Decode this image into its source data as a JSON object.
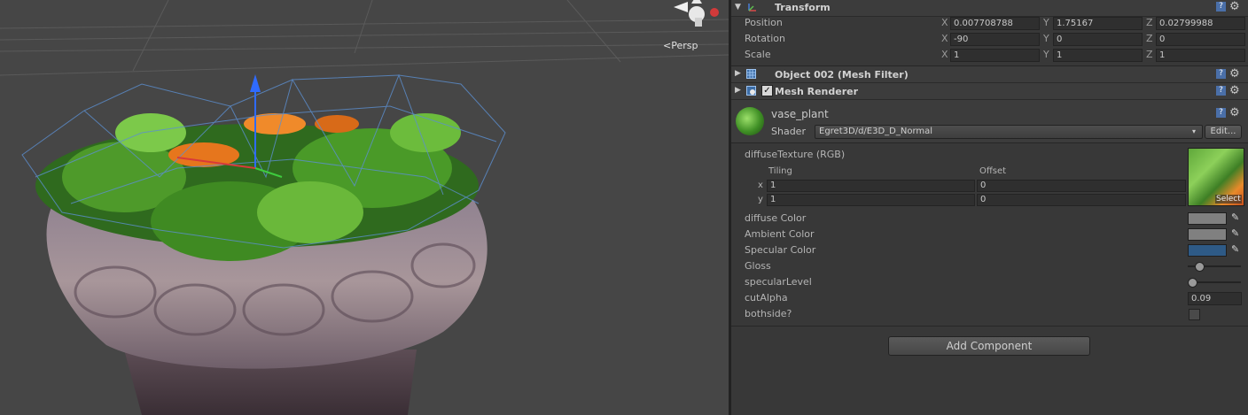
{
  "scene": {
    "view_label": "<Persp"
  },
  "transform": {
    "title": "Transform",
    "position": {
      "label": "Position",
      "x": "0.007708788",
      "y": "1.75167",
      "z": "0.02799988"
    },
    "rotation": {
      "label": "Rotation",
      "x": "-90",
      "y": "0",
      "z": "0"
    },
    "scale": {
      "label": "Scale",
      "x": "1",
      "y": "1",
      "z": "1"
    }
  },
  "axes": {
    "x": "X",
    "y": "Y",
    "z": "Z"
  },
  "mesh_filter": {
    "title": "Object 002 (Mesh Filter)"
  },
  "mesh_renderer": {
    "title": "Mesh Renderer",
    "enabled": true
  },
  "material": {
    "name": "vase_plant",
    "shader_label": "Shader",
    "shader_value": "Egret3D/d/E3D_D_Normal",
    "edit_label": "Edit...",
    "diffuse_texture_label": "diffuseTexture (RGB)",
    "tiling_label": "Tiling",
    "offset_label": "Offset",
    "row_x": "x",
    "row_y": "y",
    "tiling_x": "1",
    "tiling_y": "1",
    "offset_x": "0",
    "offset_y": "0",
    "select_label": "Select",
    "diffuse_color_label": "diffuse Color",
    "ambient_color_label": "Ambient Color",
    "specular_color_label": "Specular Color",
    "gloss_label": "Gloss",
    "gloss_value": 0.15,
    "specular_level_label": "specularLevel",
    "specular_level_value": 0.0,
    "cut_alpha_label": "cutAlpha",
    "cut_alpha_value": "0.09",
    "bothside_label": "bothside?"
  },
  "colors": {
    "diffuse": "#808080",
    "ambient": "#808080",
    "specular": "#2e5a86"
  },
  "add_component_label": "Add Component"
}
